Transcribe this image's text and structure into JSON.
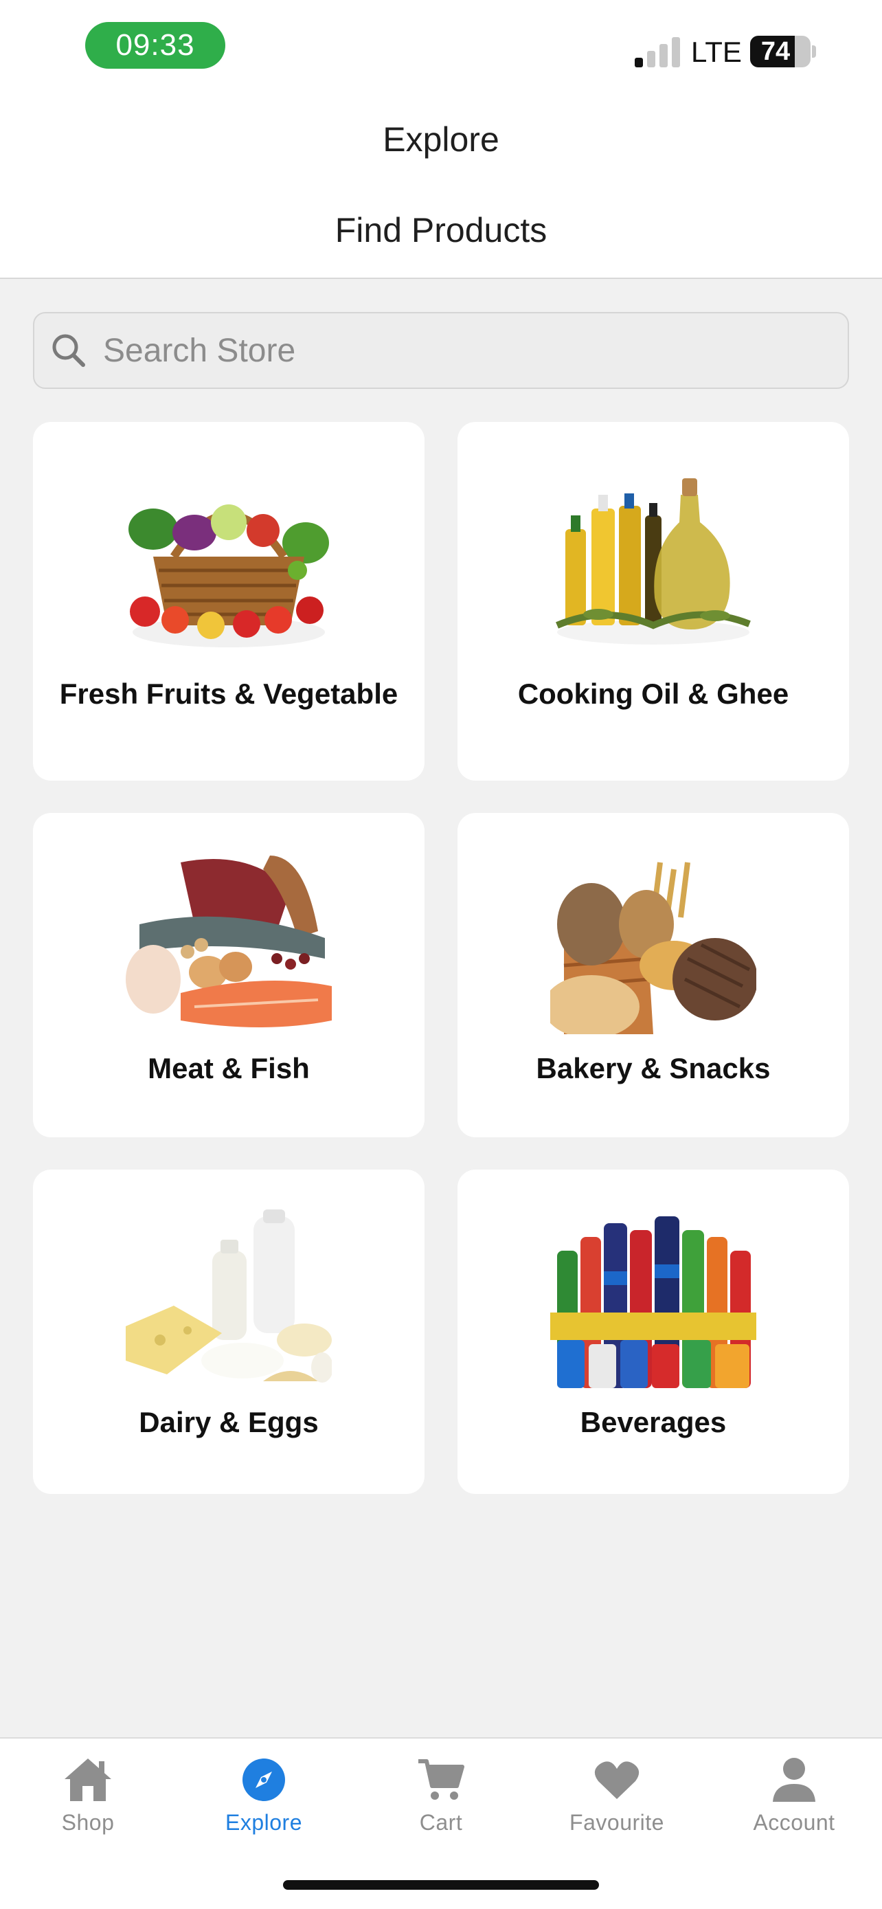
{
  "status_bar": {
    "time": "09:33",
    "network": "LTE",
    "battery": "74",
    "battery_level": 0.74,
    "signal_bars": 1,
    "time_pill_color": "#2fae4a"
  },
  "header": {
    "title": "Explore",
    "subtitle": "Find Products"
  },
  "search": {
    "placeholder": "Search Store",
    "icon": "search-icon"
  },
  "categories": [
    {
      "label": "Fresh Fruits & Vegetable",
      "image": "fruit-basket-image"
    },
    {
      "label": "Cooking Oil & Ghee",
      "image": "oil-bottles-image"
    },
    {
      "label": "Meat & Fish",
      "image": "meat-fish-image"
    },
    {
      "label": "Bakery & Snacks",
      "image": "bread-image"
    },
    {
      "label": "Dairy & Eggs",
      "image": "dairy-image"
    },
    {
      "label": "Beverages",
      "image": "beverages-image"
    }
  ],
  "tabs": [
    {
      "label": "Shop",
      "icon": "home-icon",
      "active": false
    },
    {
      "label": "Explore",
      "icon": "compass-icon",
      "active": true
    },
    {
      "label": "Cart",
      "icon": "cart-icon",
      "active": false
    },
    {
      "label": "Favourite",
      "icon": "heart-icon",
      "active": false
    },
    {
      "label": "Account",
      "icon": "person-icon",
      "active": false
    }
  ],
  "colors": {
    "accent": "#1f7fe0",
    "inactive": "#8e8e8e",
    "background": "#f1f1f1"
  }
}
